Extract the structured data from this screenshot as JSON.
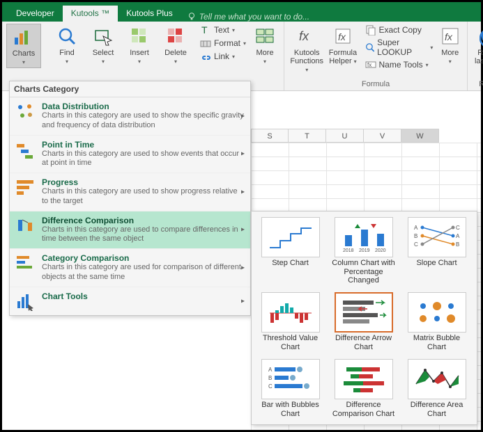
{
  "tabs": {
    "developer": "Developer",
    "kutools": "Kutools ™",
    "kutoolsplus": "Kutools Plus",
    "tellme": "Tell me what you want to do..."
  },
  "ribbon": {
    "charts": "Charts",
    "find": "Find",
    "select": "Select",
    "insert": "Insert",
    "delete": "Delete",
    "text": "Text",
    "format": "Format",
    "link": "Link",
    "more": "More",
    "kufunc": "Kutools Functions",
    "fhelper": "Formula Helper",
    "exact": "Exact Copy",
    "super": "Super LOOKUP",
    "nametools": "Name Tools",
    "more2": "More",
    "rerun": "Re-run last utiliti",
    "grp_formula": "Formula",
    "grp_rerun": "Rerun"
  },
  "panel": {
    "header": "Charts Category",
    "items": [
      {
        "title": "Data Distribution",
        "desc": "Charts in this category are used to show the specific gravity and frequency of data distribution"
      },
      {
        "title": "Point in Time",
        "desc": "Charts in this category are used to show events that occur at point in time"
      },
      {
        "title": "Progress",
        "desc": "Charts in this category are used to show progress relative to the target"
      },
      {
        "title": "Difference Comparison",
        "desc": "Charts in this category are used to compare differences in time between the same object"
      },
      {
        "title": "Category Comparison",
        "desc": "Charts in this category are used for comparison of different objects at the same time"
      },
      {
        "title": "Chart Tools",
        "desc": ""
      }
    ]
  },
  "gallery": [
    "Step Chart",
    "Column Chart with Percentage Changed",
    "Slope Chart",
    "Threshold Value Chart",
    "Difference Arrow Chart",
    "Matrix Bubble Chart",
    "Bar with Bubbles Chart",
    "Difference Comparison Chart",
    "Difference Area Chart"
  ],
  "cols": [
    "S",
    "T",
    "U",
    "V",
    "W"
  ]
}
